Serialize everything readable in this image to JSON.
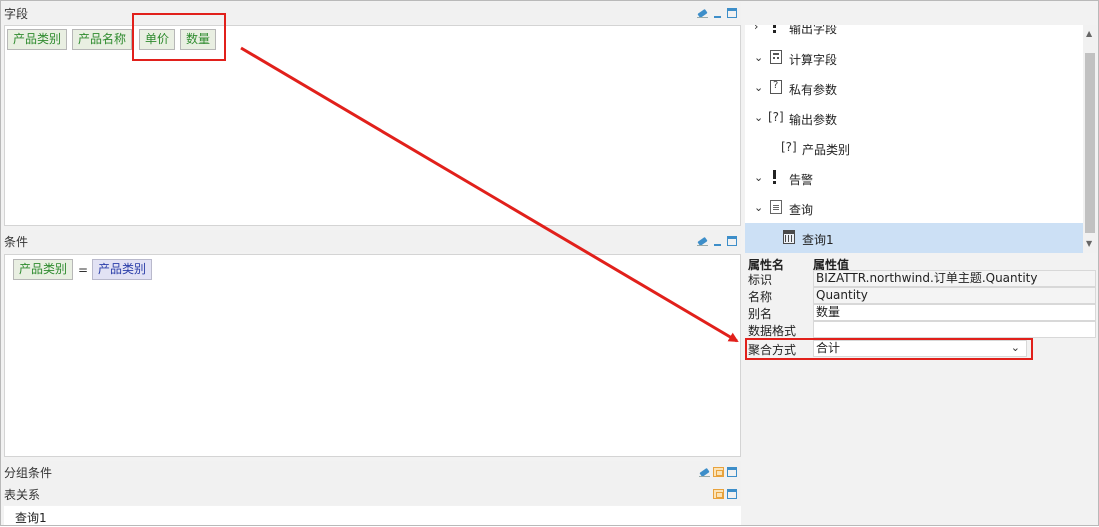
{
  "panels": {
    "fields": {
      "title": "字段",
      "chips": [
        "产品类别",
        "产品名称",
        "单价",
        "数量"
      ]
    },
    "conditions": {
      "title": "条件",
      "left_chip": "产品类别",
      "operator": "=",
      "right_chip": "产品类别"
    },
    "grouping": {
      "title": "分组条件"
    },
    "relations": {
      "title": "表关系",
      "item": "查询1"
    }
  },
  "tree": {
    "items": [
      {
        "label": "输出字段",
        "icon": "alert-icon",
        "expanded": true
      },
      {
        "label": "计算字段",
        "icon": "calculator-icon",
        "expanded": true
      },
      {
        "label": "私有参数",
        "icon": "param-icon",
        "expanded": true
      },
      {
        "label": "输出参数",
        "icon": "bracket-question-icon",
        "expanded": true
      },
      {
        "label": "产品类别",
        "icon": "bracket-question-icon",
        "child": true
      },
      {
        "label": "告警",
        "icon": "alert-icon",
        "expanded": true
      },
      {
        "label": "查询",
        "icon": "query-icon",
        "expanded": true
      },
      {
        "label": "查询1",
        "icon": "table-icon",
        "child": true,
        "selected": true
      }
    ]
  },
  "properties": {
    "name_header": "属性名",
    "value_header": "属性值",
    "rows": [
      {
        "name": "标识",
        "value": "BIZATTR.northwind.订单主题.Quantity"
      },
      {
        "name": "名称",
        "value": "Quantity"
      },
      {
        "name": "别名",
        "value": "数量"
      },
      {
        "name": "数据格式",
        "value": ""
      },
      {
        "name": "聚合方式",
        "value": "合计",
        "is_select": true
      }
    ]
  },
  "colors": {
    "highlight_red": "#e1201b",
    "selected_row": "#cce0f5",
    "chip_green_text": "#2e8b2e",
    "chip_blue_text": "#2a3da8"
  }
}
